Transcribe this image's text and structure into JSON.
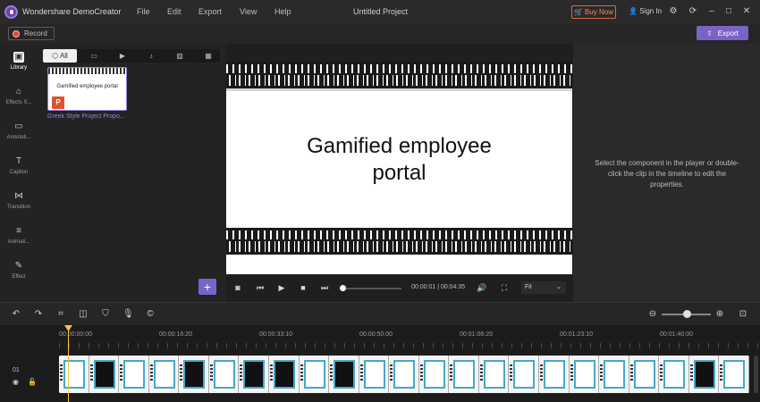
{
  "titlebar": {
    "app_title": "Wondershare DemoCreator",
    "menu": [
      "File",
      "Edit",
      "Export",
      "View",
      "Help"
    ],
    "project_title": "Untitled Project",
    "buy_now": "Buy Now",
    "sign_in": "Sign In"
  },
  "recbar": {
    "record_label": "Record",
    "export_label": "Export"
  },
  "sidebar": {
    "items": [
      {
        "label": "Library",
        "icon": "library-icon"
      },
      {
        "label": "Effects S...",
        "icon": "effects-icon"
      },
      {
        "label": "Annotati...",
        "icon": "annotation-icon"
      },
      {
        "label": "Caption",
        "icon": "caption-icon"
      },
      {
        "label": "Transition",
        "icon": "transition-icon"
      },
      {
        "label": "Animati...",
        "icon": "animation-icon"
      },
      {
        "label": "Effect",
        "icon": "effect-wand-icon"
      }
    ]
  },
  "library": {
    "tab_all": "All",
    "media_name": "Greek Style Project Propo...",
    "thumb_text": "Gamified employee portal",
    "badge": "P"
  },
  "preview": {
    "slide_title_line1": "Gamified employee",
    "slide_title_line2": "portal",
    "timecode": "00:00:01 | 00:04:35",
    "fit": "Fit"
  },
  "properties": {
    "hint": "Select the component in the player or double-click the clip in the timeline to edit the properties."
  },
  "timeline": {
    "ruler_labels": [
      "00:00:00:00",
      "00:00:16:20",
      "00:00:33:10",
      "00:00:50:00",
      "00:01:06:20",
      "00:01:23:10",
      "00:01:40:00"
    ],
    "track_number": "01"
  }
}
